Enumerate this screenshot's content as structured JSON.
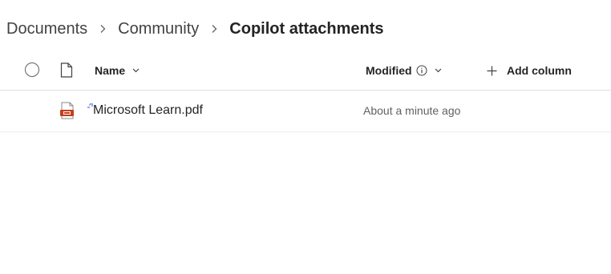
{
  "breadcrumb": {
    "items": [
      "Documents",
      "Community"
    ],
    "current": "Copilot attachments"
  },
  "header": {
    "name_label": "Name",
    "modified_label": "Modified",
    "add_column_label": "Add column"
  },
  "rows": [
    {
      "name": "Microsoft Learn.pdf",
      "modified": "About a minute ago",
      "file_type_icon": "pdf-icon"
    }
  ],
  "colors": {
    "pdf_red": "#c43e1c",
    "new_marker": "#4f6bed",
    "text": "#242424",
    "muted": "#616161"
  }
}
